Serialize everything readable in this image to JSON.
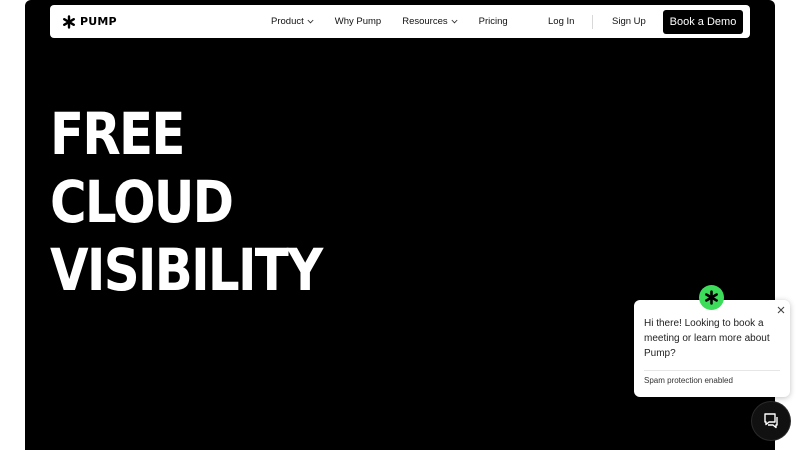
{
  "brand": {
    "name": "PUMP",
    "logo_icon": "asterisk-icon"
  },
  "nav": {
    "items": [
      {
        "label": "Product",
        "has_dropdown": true
      },
      {
        "label": "Why Pump",
        "has_dropdown": false
      },
      {
        "label": "Resources",
        "has_dropdown": true
      },
      {
        "label": "Pricing",
        "has_dropdown": false
      }
    ],
    "login_label": "Log In",
    "signup_label": "Sign Up",
    "demo_label": "Book a Demo"
  },
  "hero": {
    "lines": [
      "FREE",
      "CLOUD",
      "VISIBILITY"
    ]
  },
  "chat": {
    "message": "Hi there! Looking to book a meeting or learn more about Pump?",
    "spam_note": "Spam protection enabled",
    "avatar_icon": "asterisk-icon",
    "close_icon": "close-icon",
    "launcher_icon": "chat-bubbles-icon"
  },
  "colors": {
    "hero_background": "#000000",
    "accent_green": "#3ddc5a",
    "button_background": "#000000",
    "text_light": "#ffffff"
  }
}
